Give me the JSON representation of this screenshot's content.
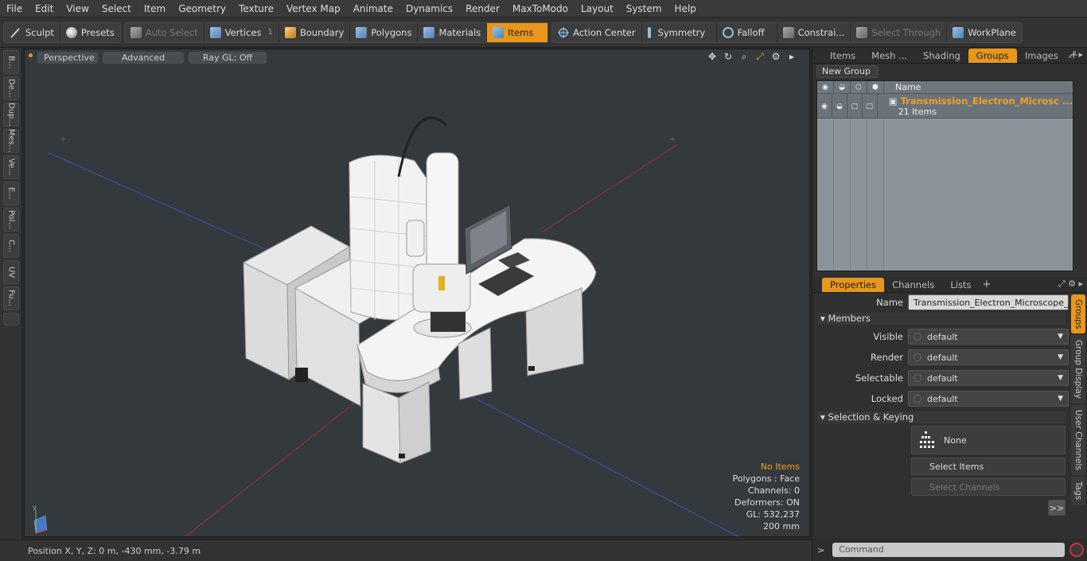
{
  "menu": [
    "File",
    "Edit",
    "View",
    "Select",
    "Item",
    "Geometry",
    "Texture",
    "Vertex Map",
    "Animate",
    "Dynamics",
    "Render",
    "MaxToModo",
    "Layout",
    "System",
    "Help"
  ],
  "toolbar": {
    "sculpt": "Sculpt",
    "presets": "Presets",
    "auto_select": "Auto Select",
    "vertices": "Vertices",
    "vertices_count": "1",
    "boundary": "Boundary",
    "polygons": "Polygons",
    "materials": "Materials",
    "items": "Items",
    "action_center": "Action Center",
    "symmetry": "Symmetry",
    "falloff": "Falloff",
    "constraints": "Constrai...",
    "select_through": "Select Through",
    "workplane": "WorkPlane"
  },
  "left_tabs": [
    "B...",
    "De...",
    "Dup...",
    "Mes...",
    "Ve...",
    "E...",
    "Pol...",
    "C...",
    "UV",
    "Fu..."
  ],
  "viewport": {
    "view_mode": "Perspective",
    "shading": "Advanced",
    "raygl": "Ray GL: Off",
    "info": {
      "selection": "No Items",
      "polygons": "Polygons : Face",
      "channels": "Channels: 0",
      "deformers": "Deformers: ON",
      "gl": "GL: 532,237",
      "scale": "200 mm"
    }
  },
  "status": {
    "position": "Position X, Y, Z:   0 m, -430 mm, -3.79 m"
  },
  "top_panel": {
    "tabs": [
      "Items",
      "Mesh ...",
      "Shading",
      "Groups",
      "Images"
    ],
    "active_tab": "Groups",
    "new_group": "New Group",
    "name_header": "Name",
    "group": {
      "name": "Transmission_Electron_Microsc ...",
      "count": "21 Items"
    }
  },
  "properties": {
    "tabs": [
      "Properties",
      "Channels",
      "Lists"
    ],
    "active_tab": "Properties",
    "name_label": "Name",
    "name_value": "Transmission_Electron_Microscope_Wi",
    "members_label": "Members",
    "visible_label": "Visible",
    "visible_value": "default",
    "render_label": "Render",
    "render_value": "default",
    "selectable_label": "Selectable",
    "selectable_value": "default",
    "locked_label": "Locked",
    "locked_value": "default",
    "selection_keying_label": "Selection & Keying",
    "none_label": "None",
    "select_items": "Select Items",
    "select_channels": "Select Channels",
    "more": ">>"
  },
  "side_tabs": [
    "Groups",
    "Group Display",
    "User Channels",
    "Tags"
  ],
  "command": {
    "prompt": ">",
    "placeholder": "Command"
  },
  "colors": {
    "accent": "#e8971c",
    "viewport_bg": "#34393d"
  }
}
